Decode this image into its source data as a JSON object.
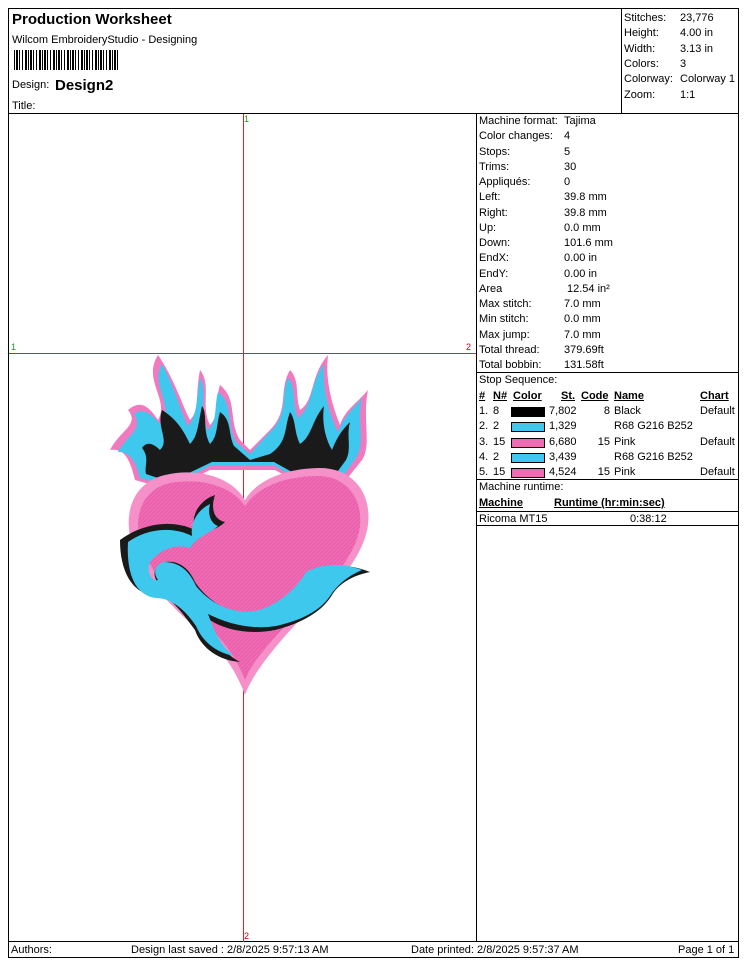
{
  "header": {
    "title": "Production Worksheet",
    "subtitle": "Wilcom EmbroideryStudio - Designing",
    "design_label": "Design:",
    "design_name": "Design2",
    "title_label": "Title:"
  },
  "summary": [
    {
      "label": "Stitches:",
      "value": "23,776"
    },
    {
      "label": "Height:",
      "value": "4.00 in"
    },
    {
      "label": "Width:",
      "value": "3.13 in"
    },
    {
      "label": "Colors:",
      "value": "3"
    },
    {
      "label": "Colorway:",
      "value": "Colorway 1"
    },
    {
      "label": "Zoom:",
      "value": "1:1"
    }
  ],
  "machine_info": [
    {
      "label": "Machine format:",
      "value": "Tajima"
    },
    {
      "label": "Color changes:",
      "value": "4"
    },
    {
      "label": "Stops:",
      "value": "5"
    },
    {
      "label": "Trims:",
      "value": "30"
    },
    {
      "label": "Appliqués:",
      "value": "0"
    },
    {
      "label": "Left:",
      "value": "39.8 mm"
    },
    {
      "label": "Right:",
      "value": "39.8 mm"
    },
    {
      "label": "Up:",
      "value": "0.0 mm"
    },
    {
      "label": "Down:",
      "value": "101.6 mm"
    },
    {
      "label": "EndX:",
      "value": "0.00 in"
    },
    {
      "label": "EndY:",
      "value": "0.00 in"
    },
    {
      "label": "Area",
      "value": "12.54 in²"
    },
    {
      "label": "Max stitch:",
      "value": "7.0 mm"
    },
    {
      "label": "Min stitch:",
      "value": "0.0 mm"
    },
    {
      "label": "Max jump:",
      "value": "7.0 mm"
    },
    {
      "label": "Total thread:",
      "value": "379.69ft"
    },
    {
      "label": "Total bobbin:",
      "value": "131.58ft"
    }
  ],
  "stop_sequence": {
    "title": "Stop Sequence:",
    "headers": {
      "num": "#",
      "n": "N#",
      "color": "Color",
      "st": "St.",
      "code": "Code",
      "name": "Name",
      "chart": "Chart"
    },
    "rows": [
      {
        "num": "1.",
        "n": "8",
        "swatch": "#000000",
        "st": "7,802",
        "code": "8",
        "name": "Black",
        "chart": "Default"
      },
      {
        "num": "2.",
        "n": "2",
        "swatch": "#3ec8ee",
        "st": "1,329",
        "code": "",
        "name": "R68 G216 B252",
        "chart": ""
      },
      {
        "num": "3.",
        "n": "15",
        "swatch": "#f06ab4",
        "st": "6,680",
        "code": "15",
        "name": "Pink",
        "chart": "Default"
      },
      {
        "num": "4.",
        "n": "2",
        "swatch": "#3ec8ee",
        "st": "3,439",
        "code": "",
        "name": "R68 G216 B252",
        "chart": ""
      },
      {
        "num": "5.",
        "n": "15",
        "swatch": "#f06ab4",
        "st": "4,524",
        "code": "15",
        "name": "Pink",
        "chart": "Default"
      }
    ]
  },
  "runtime": {
    "title": "Machine runtime:",
    "col_machine": "Machine",
    "col_runtime": "Runtime (hr:min:sec)",
    "machine": "Ricoma MT15",
    "time": "0:38:12"
  },
  "markers": {
    "top": "1",
    "left": "1",
    "right": "2",
    "bottom": "2"
  },
  "footer": {
    "authors": "Authors:",
    "saved": "Design last saved : 2/8/2025 9:57:13 AM",
    "printed": "Date printed: 2/8/2025 9:57:37 AM",
    "page": "Page 1 of 1"
  },
  "colors": {
    "pink": "#f06ab4",
    "pink_dark": "#e87fc0",
    "cyan": "#3ec8ee",
    "black": "#1a1a1a",
    "guide": "#dd2222"
  }
}
